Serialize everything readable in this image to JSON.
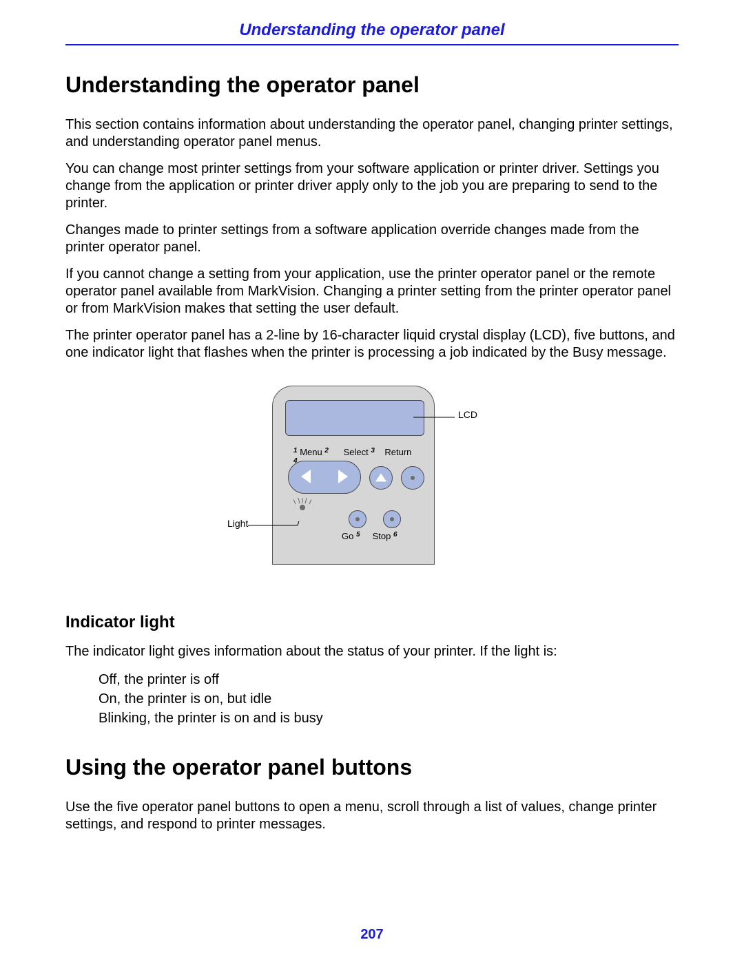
{
  "header": {
    "title": "Understanding the operator panel"
  },
  "section1": {
    "heading": "Understanding the operator panel",
    "p1": "This section contains information about understanding the operator panel, changing printer settings, and understanding operator panel menus.",
    "p2": "You can change most printer settings from your software application or printer driver. Settings you change from the application or printer driver apply only to the job you are preparing to send to the printer.",
    "p3": "Changes made to printer settings from a software application override changes made from the printer operator panel.",
    "p4": "If you cannot change a setting from your application, use the printer operator panel or the remote operator panel available from MarkVision. Changing a printer setting from the printer operator panel or from MarkVision makes that setting the user default.",
    "p5": "The printer operator panel has a 2-line by 16-character liquid crystal display (LCD), five buttons, and one indicator light that flashes when the printer is processing a job indicated by the Busy message."
  },
  "figure": {
    "lcd_label": "LCD",
    "light_label": "Light",
    "menu_label": "Menu",
    "select_label": "Select",
    "return_label": "Return",
    "go_label": "Go",
    "stop_label": "Stop",
    "sup1": "1",
    "sup2": "2",
    "sup3": "3",
    "sup4": "4",
    "sup5": "5",
    "sup6": "6"
  },
  "section2": {
    "heading": "Indicator light",
    "p1": "The indicator light gives information about the status of your printer. If the light is:",
    "li1": "Off, the printer is off",
    "li2": "On, the printer is on, but idle",
    "li3": "Blinking, the printer is on and is busy"
  },
  "section3": {
    "heading": "Using the operator panel buttons",
    "p1": "Use the five operator panel buttons to open a menu, scroll through a list of values, change printer settings, and respond to printer messages."
  },
  "page_number": "207"
}
